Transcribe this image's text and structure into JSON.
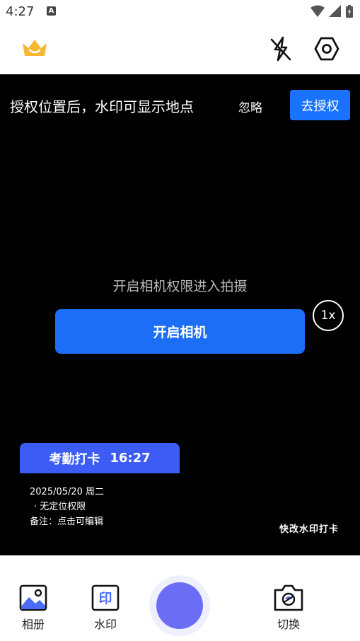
{
  "status_bar": {
    "time": "4:27",
    "notif_letter": "A"
  },
  "banner": {
    "message": "授权位置后，水印可显示地点",
    "ignore_label": "忽略",
    "authorize_label": "去授权"
  },
  "camera": {
    "permission_text": "开启相机权限进入拍摄",
    "open_button_label": "开启相机",
    "zoom_label": "1x"
  },
  "watermark": {
    "title": "考勤打卡",
    "time": "16:27",
    "date_line": "2025/05/20 周二",
    "location_line": "· 无定位权限",
    "note_line": "备注：点击可编辑",
    "quick_edit_label": "快改水印打卡"
  },
  "bottom_nav": {
    "album_label": "相册",
    "watermark_icon_char": "印",
    "watermark_label": "水印",
    "switch_label": "切换"
  },
  "colors": {
    "primary_blue": "#1b6ef5",
    "watermark_blue": "#3d5cf5",
    "shutter": "#6b6ef5",
    "crown": "#f7b733"
  }
}
